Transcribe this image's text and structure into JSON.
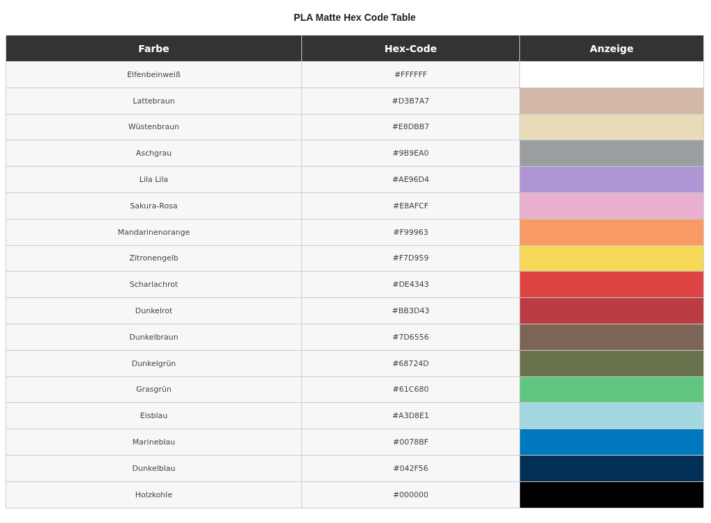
{
  "title": "PLA Matte Hex Code Table",
  "table": {
    "columns": [
      "Farbe",
      "Hex-Code",
      "Anzeige"
    ],
    "rows": [
      {
        "name": "Elfenbeinweiß",
        "hex": "#FFFFFF",
        "color": "#ffffff"
      },
      {
        "name": "Lattebraun",
        "hex": "#D3B7A7",
        "color": "#d3b7a7"
      },
      {
        "name": "Wüstenbraun",
        "hex": "#E8DBB7",
        "color": "#e8dbb7"
      },
      {
        "name": "Aschgrau",
        "hex": "#9B9EA0",
        "color": "#9b9ea0"
      },
      {
        "name": "Lila Lila",
        "hex": "#AE96D4",
        "color": "#ae96d4"
      },
      {
        "name": "Sakura-Rosa",
        "hex": "#E8AFCF",
        "color": "#e8afcf"
      },
      {
        "name": "Mandarinenorange",
        "hex": "#F99963",
        "color": "#f99963"
      },
      {
        "name": "Zitronengelb",
        "hex": "#F7D959",
        "color": "#f7d959"
      },
      {
        "name": "Scharlachrot",
        "hex": "#DE4343",
        "color": "#de4343"
      },
      {
        "name": "Dunkelrot",
        "hex": "#BB3D43",
        "color": "#bb3d43"
      },
      {
        "name": "Dunkelbraun",
        "hex": "#7D6556",
        "color": "#7d6556"
      },
      {
        "name": "Dunkelgrün",
        "hex": "#68724D",
        "color": "#68724d"
      },
      {
        "name": "Grasgrün",
        "hex": "#61C680",
        "color": "#61c680"
      },
      {
        "name": "Eisblau",
        "hex": "#A3D8E1",
        "color": "#a3d8e1"
      },
      {
        "name": "Marineblau",
        "hex": "#0078BF",
        "color": "#0078bf"
      },
      {
        "name": "Dunkelblau",
        "hex": "#042F56",
        "color": "#042f56"
      },
      {
        "name": "Holzkohle",
        "hex": "#000000",
        "color": "#000000"
      }
    ]
  }
}
